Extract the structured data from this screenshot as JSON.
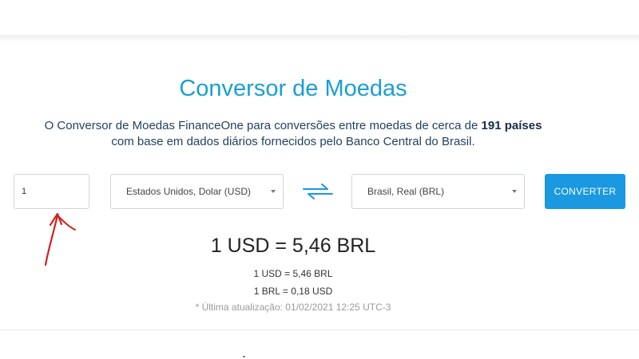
{
  "converter": {
    "title": "Conversor de Moedas",
    "description_line1_prefix": "O Conversor de Moedas FinanceOne para conversões entre moedas de cerca de ",
    "description_line1_bold": "191 países",
    "description_line2": "com base em dados diários fornecidos pelo Banco Central do Brasil.",
    "amount_value": "1",
    "from_currency": "Estados Unidos, Dolar (USD)",
    "to_currency": "Brasil, Real (BRL)",
    "convert_label": "CONVERTER",
    "result_main": "1 USD = 5,46 BRL",
    "rate_usd_brl": "1 USD = 5,46 BRL",
    "rate_brl_usd": "1 BRL = 0,18 USD",
    "last_update": "* Última atualização: 01/02/2021 12:25 UTC-3"
  },
  "icons": {
    "swap": "swap-arrows-icon",
    "annotation": "red-arrow-annotation"
  },
  "colors": {
    "title": "#1a9ed6",
    "button": "#1a98e0",
    "swap_icon": "#1a98e0",
    "annotation": "#d42020"
  }
}
